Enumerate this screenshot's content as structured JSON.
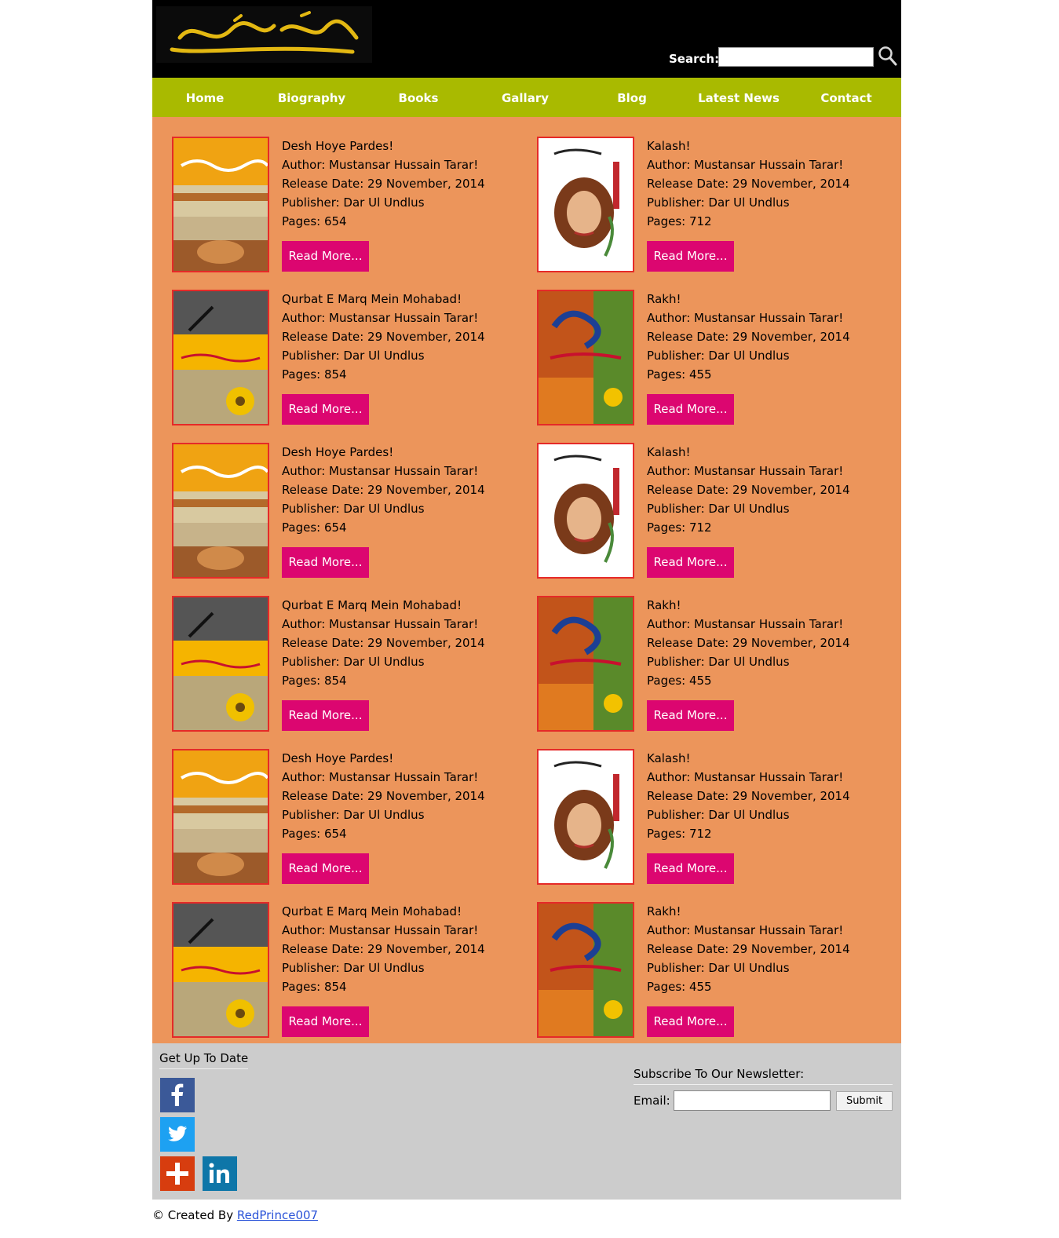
{
  "header": {
    "logo_text": "مستنصر حسین تارڑ",
    "search_label": "Search:",
    "search_value": ""
  },
  "nav": [
    {
      "label": "Home"
    },
    {
      "label": "Biography"
    },
    {
      "label": "Books"
    },
    {
      "label": "Gallary"
    },
    {
      "label": "Blog"
    },
    {
      "label": "Latest News"
    },
    {
      "label": "Contact"
    }
  ],
  "books": [
    {
      "title": "Desh Hoye Pardes!",
      "author": "Author: Mustansar Hussain Tarar!",
      "release": "Release Date: 29 November, 2014",
      "publisher": "Publisher: Dar Ul Undlus",
      "pages": "Pages: 654",
      "read_more": "Read More...",
      "cover": "desh"
    },
    {
      "title": "Kalash!",
      "author": "Author: Mustansar Hussain Tarar!",
      "release": "Release Date: 29 November, 2014",
      "publisher": "Publisher: Dar Ul Undlus",
      "pages": "Pages: 712",
      "read_more": "Read More...",
      "cover": "kalash"
    },
    {
      "title": "Qurbat E Marq Mein Mohabad!",
      "author": "Author: Mustansar Hussain Tarar!",
      "release": "Release Date: 29 November, 2014",
      "publisher": "Publisher: Dar Ul Undlus",
      "pages": "Pages: 854",
      "read_more": "Read More...",
      "cover": "qurbat"
    },
    {
      "title": "Rakh!",
      "author": "Author: Mustansar Hussain Tarar!",
      "release": "Release Date: 29 November, 2014",
      "publisher": "Publisher: Dar Ul Undlus",
      "pages": "Pages: 455",
      "read_more": "Read More...",
      "cover": "rakh"
    },
    {
      "title": "Desh Hoye Pardes!",
      "author": "Author: Mustansar Hussain Tarar!",
      "release": "Release Date: 29 November, 2014",
      "publisher": "Publisher: Dar Ul Undlus",
      "pages": "Pages: 654",
      "read_more": "Read More...",
      "cover": "desh"
    },
    {
      "title": "Kalash!",
      "author": "Author: Mustansar Hussain Tarar!",
      "release": "Release Date: 29 November, 2014",
      "publisher": "Publisher: Dar Ul Undlus",
      "pages": "Pages: 712",
      "read_more": "Read More...",
      "cover": "kalash"
    },
    {
      "title": "Qurbat E Marq Mein Mohabad!",
      "author": "Author: Mustansar Hussain Tarar!",
      "release": "Release Date: 29 November, 2014",
      "publisher": "Publisher: Dar Ul Undlus",
      "pages": "Pages: 854",
      "read_more": "Read More...",
      "cover": "qurbat"
    },
    {
      "title": "Rakh!",
      "author": "Author: Mustansar Hussain Tarar!",
      "release": "Release Date: 29 November, 2014",
      "publisher": "Publisher: Dar Ul Undlus",
      "pages": "Pages: 455",
      "read_more": "Read More...",
      "cover": "rakh"
    },
    {
      "title": "Desh Hoye Pardes!",
      "author": "Author: Mustansar Hussain Tarar!",
      "release": "Release Date: 29 November, 2014",
      "publisher": "Publisher: Dar Ul Undlus",
      "pages": "Pages: 654",
      "read_more": "Read More...",
      "cover": "desh"
    },
    {
      "title": "Kalash!",
      "author": "Author: Mustansar Hussain Tarar!",
      "release": "Release Date: 29 November, 2014",
      "publisher": "Publisher: Dar Ul Undlus",
      "pages": "Pages: 712",
      "read_more": "Read More...",
      "cover": "kalash"
    },
    {
      "title": "Qurbat E Marq Mein Mohabad!",
      "author": "Author: Mustansar Hussain Tarar!",
      "release": "Release Date: 29 November, 2014",
      "publisher": "Publisher: Dar Ul Undlus",
      "pages": "Pages: 854",
      "read_more": "Read More...",
      "cover": "qurbat"
    },
    {
      "title": "Rakh!",
      "author": "Author: Mustansar Hussain Tarar!",
      "release": "Release Date: 29 November, 2014",
      "publisher": "Publisher: Dar Ul Undlus",
      "pages": "Pages: 455",
      "read_more": "Read More...",
      "cover": "rakh"
    }
  ],
  "footer": {
    "get_up_to_date": "Get Up To Date",
    "social": [
      {
        "icon": "facebook-icon",
        "color": "#3b5998"
      },
      {
        "icon": "twitter-icon",
        "color": "#1da1f2"
      },
      {
        "icon": "google-plus-icon",
        "color": "#d73d0f"
      },
      {
        "icon": "linkedin-icon",
        "color": "#0e76a8"
      }
    ],
    "newsletter_title": "Subscribe To Our Newsletter:",
    "email_label": "Email:",
    "email_value": "",
    "submit_label": "Submit"
  },
  "credit": {
    "prefix": "© Created By ",
    "link_text": "RedPrince007"
  },
  "colors": {
    "header_bg": "#000000",
    "nav_bg": "#a9ba00",
    "content_bg": "#ec955b",
    "button_bg": "#dc0670",
    "cover_border": "#e52a28",
    "footer_bg": "#cccccc"
  }
}
